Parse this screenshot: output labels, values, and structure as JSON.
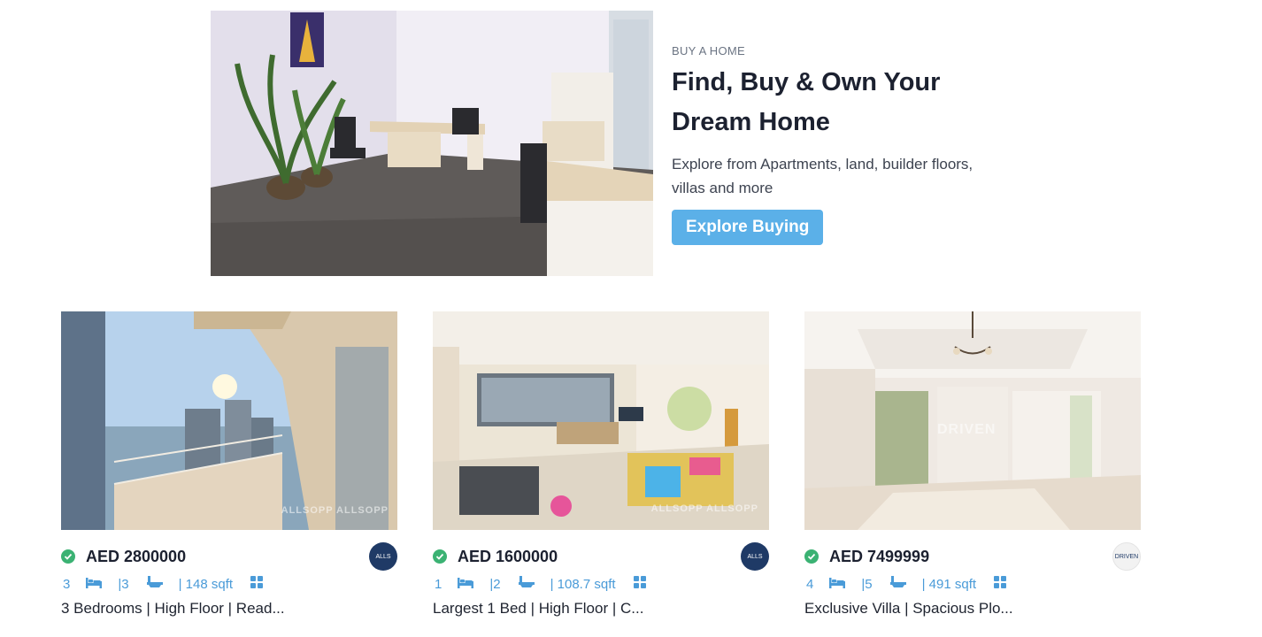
{
  "hero": {
    "eyebrow": "BUY A HOME",
    "title": "Find, Buy & Own Your Dream Home",
    "description": "Explore from Apartments, land, builder floors, villas and more",
    "button_label": "Explore Buying"
  },
  "colors": {
    "accent": "#5bb0e8",
    "spec_text": "#4a9bd8",
    "verified": "#3bb273",
    "title_text": "#1c2130"
  },
  "listings": [
    {
      "price": "AED 2800000",
      "beds": "3",
      "baths": "|3",
      "area": "| 148 sqft",
      "title": "3 Bedrooms | High Floor | Read...",
      "agency_logo": "ALLS",
      "watermark": "ALLSOPP ALLSOPP"
    },
    {
      "price": "AED 1600000",
      "beds": "1",
      "baths": "|2",
      "area": "| 108.7 sqft",
      "title": "Largest 1 Bed | High Floor | C...",
      "agency_logo": "ALLS",
      "watermark": "ALLSOPP ALLSOPP"
    },
    {
      "price": "AED 7499999",
      "beds": "4",
      "baths": "|5",
      "area": "| 491 sqft",
      "title": "Exclusive Villa | Spacious Plo...",
      "agency_logo": "DRIVEN",
      "watermark": "DRIVEN"
    }
  ],
  "icons": {
    "verified": "check-circle-icon",
    "bed": "bed-icon",
    "bath": "bathtub-icon",
    "more": "grid-icon"
  }
}
